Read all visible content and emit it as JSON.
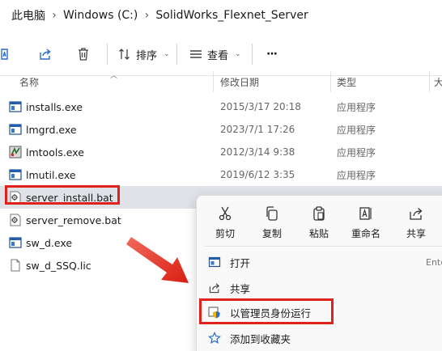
{
  "breadcrumb": {
    "items": [
      "此电脑",
      "Windows (C:)",
      "SolidWorks_Flexnet_Server"
    ],
    "separator": "›"
  },
  "toolbar": {
    "sort_label": "排序",
    "view_label": "查看",
    "more_label": "···"
  },
  "columns": {
    "name": "名称",
    "date": "修改日期",
    "type": "类型",
    "size": "大"
  },
  "files": [
    {
      "name": "installs.exe",
      "date": "2015/3/17 20:18",
      "type": "应用程序",
      "icon": "exe-icon"
    },
    {
      "name": "lmgrd.exe",
      "date": "2023/7/1 17:26",
      "type": "应用程序",
      "icon": "exe-icon"
    },
    {
      "name": "lmtools.exe",
      "date": "2012/3/14 9:38",
      "type": "应用程序",
      "icon": "lmtools-icon"
    },
    {
      "name": "lmutil.exe",
      "date": "2019/6/12 3:35",
      "type": "应用程序",
      "icon": "exe-icon"
    },
    {
      "name": "server_install.bat",
      "date": "",
      "type": "",
      "icon": "bat-icon",
      "selected": true
    },
    {
      "name": "server_remove.bat",
      "date": "",
      "type": "",
      "icon": "bat-icon"
    },
    {
      "name": "sw_d.exe",
      "date": "",
      "type": "",
      "icon": "exe-icon"
    },
    {
      "name": "sw_d_SSQ.lic",
      "date": "",
      "type": "",
      "icon": "file-icon"
    }
  ],
  "context_menu": {
    "quick_actions": [
      {
        "label": "剪切",
        "icon": "scissors-icon"
      },
      {
        "label": "复制",
        "icon": "copy-icon"
      },
      {
        "label": "粘贴",
        "icon": "paste-icon"
      },
      {
        "label": "重命名",
        "icon": "rename-icon"
      },
      {
        "label": "共享",
        "icon": "share-icon"
      }
    ],
    "items": [
      {
        "label": "打开",
        "shortcut": "Ente",
        "icon": "open-icon"
      },
      {
        "label": "共享",
        "shortcut": "",
        "icon": "share-icon"
      },
      {
        "label": "以管理员身份运行",
        "shortcut": "",
        "icon": "shield-icon"
      },
      {
        "label": "添加到收藏夹",
        "shortcut": "",
        "icon": "star-icon"
      }
    ]
  },
  "colors": {
    "highlight": "#e0231a",
    "accent": "#2a6cc8",
    "selected_row": "#dfe3e8"
  }
}
